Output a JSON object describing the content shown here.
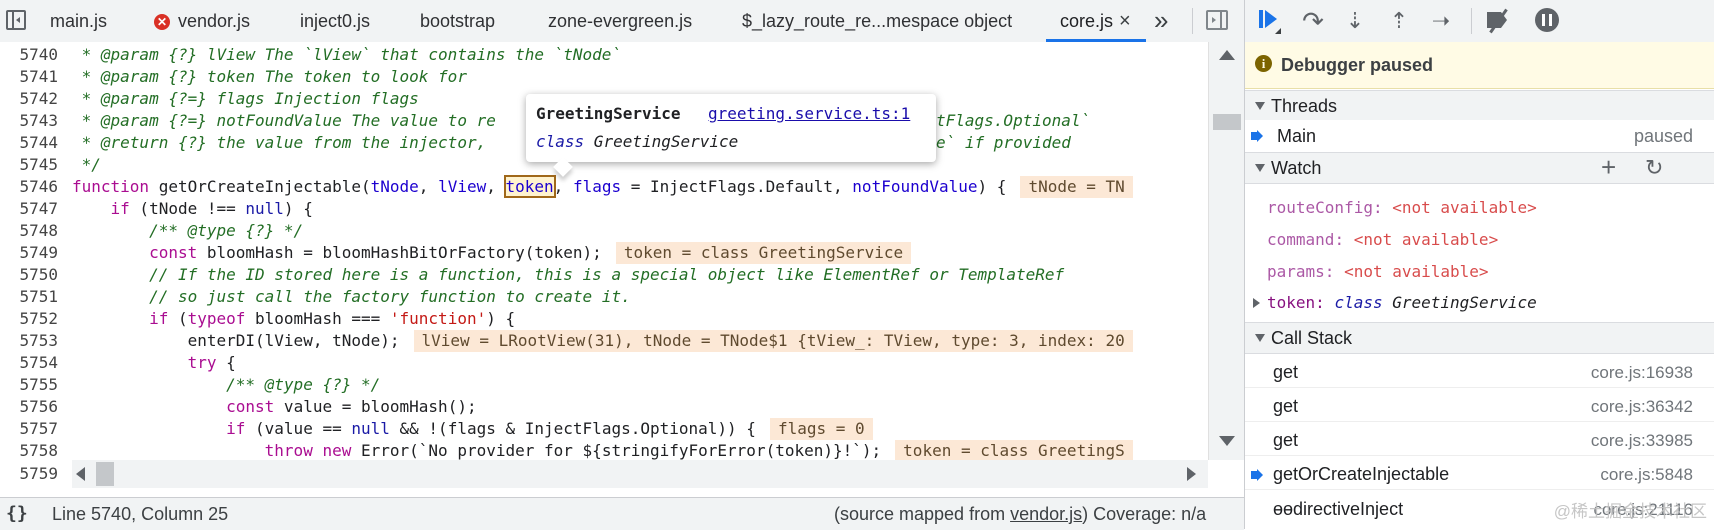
{
  "tabs": [
    {
      "label": "main.js"
    },
    {
      "label": "vendor.js",
      "has_error": true
    },
    {
      "label": "inject0.js"
    },
    {
      "label": "bootstrap"
    },
    {
      "label": "zone-evergreen.js"
    },
    {
      "label": "$_lazy_route_re...mespace object"
    },
    {
      "label": "core.js",
      "active": true,
      "close_icon": "×"
    }
  ],
  "tab_overflow_icon": "»",
  "code": {
    "line_numbers": [
      "5740",
      "5741",
      "5742",
      "5743",
      "5744",
      "5745",
      "5746",
      "5747",
      "5748",
      "5749",
      "5750",
      "5751",
      "5752",
      "5753",
      "5754",
      "5755",
      "5756",
      "5757",
      "5758"
    ],
    "last_line_number": "5759",
    "l5740": " * @param {?} lView The `lView` that contains the `tNode`",
    "l5741": " * @param {?} token The token to look for",
    "l5742": " * @param {?=} flags Injection flags",
    "l5743a": " * @param {?=} notFoundValue The value to re",
    "l5743b": "tFlags.Optional`",
    "l5744a": " * @return {?} the value from the injector,",
    "l5744b": "e` if provided",
    "l5745": " */",
    "l5746": {
      "kw": "function",
      "fn": " getOrCreateInjectable",
      "p1": "(",
      "a1": "tNode",
      "p2": ", ",
      "a2": "lView",
      "p3": ", ",
      "a3": "token",
      "p4": ", ",
      "a4": "flags",
      "p5": " = InjectFlags.Default, ",
      "a5": "notFoundValue",
      "p6": ") {",
      "val": "tNode = TN"
    },
    "l5747": {
      "indent": "    ",
      "kw": "if",
      "rest_a": " (tNode !== ",
      "kwb": "null",
      "rest_b": ") {"
    },
    "l5748": {
      "indent": "        ",
      "cm": "/** @type {?} */"
    },
    "l5749": {
      "indent": "        ",
      "kw": "const",
      "rest": " bloomHash = bloomHashBitOrFactory(token);",
      "val": "token = class GreetingService"
    },
    "l5750": {
      "indent": "        ",
      "cm": "// If the ID stored here is a function, this is a special object like ElementRef or TemplateRef"
    },
    "l5751": {
      "indent": "        ",
      "cm": "// so just call the factory function to create it."
    },
    "l5752": {
      "indent": "        ",
      "kw": "if",
      "rest_a": " (",
      "kw2": "typeof",
      "rest_b": " bloomHash === ",
      "str": "'function'",
      "rest_c": ") {"
    },
    "l5753": {
      "indent": "            ",
      "rest": "enterDI(lView, tNode);",
      "val": "lView = LRootView(31), tNode = TNode$1 {tView_: TView, type: 3, index: 20"
    },
    "l5754": {
      "indent": "            ",
      "kw": "try",
      "rest": " {"
    },
    "l5755": {
      "indent": "                ",
      "cm": "/** @type {?} */"
    },
    "l5756": {
      "indent": "                ",
      "kw": "const",
      "rest": " value = bloomHash();"
    },
    "l5757": {
      "indent": "                ",
      "kw": "if",
      "rest_a": " (value == ",
      "kwb": "null",
      "rest_b": " && !(flags & InjectFlags.Optional)) {",
      "val": "flags = 0"
    },
    "l5758": {
      "indent": "                    ",
      "kw": "throw new",
      "rest_a": " Error(`No provider for ${stringifyForError(token)}!`);",
      "val": "token = class GreetingS"
    }
  },
  "tooltip": {
    "name": "GreetingService",
    "link": "greeting.service.ts:1",
    "class_kw": "class",
    "class_name": " GreetingService"
  },
  "status": {
    "icon": "{}",
    "position": "Line 5740, Column 25",
    "source_prefix": "(source mapped from ",
    "source_file": "vendor.js",
    "source_suffix": ")",
    "coverage": " Coverage: n/a"
  },
  "debugger": {
    "toolbar_icons": [
      "resume-icon",
      "step-over-icon",
      "step-into-icon",
      "step-out-icon",
      "step-icon",
      "deactivate-breakpoints-icon",
      "pause-on-exceptions-icon"
    ],
    "paused_message": "Debugger paused",
    "threads_title": "Threads",
    "thread": {
      "name": "Main",
      "status": "paused"
    },
    "watch_title": "Watch",
    "watch_add": "+",
    "watch_refresh": "↻",
    "watch": [
      {
        "name": "routeConfig",
        "value": "<not available>"
      },
      {
        "name": "command",
        "value": "<not available>"
      },
      {
        "name": "params",
        "value": "<not available>"
      }
    ],
    "watch_token": {
      "name": "token",
      "kw": "class",
      "value": " GreetingService"
    },
    "callstack_title": "Call Stack",
    "callstack": [
      {
        "name": "get",
        "location": "core.js:16938"
      },
      {
        "name": "get",
        "location": "core.js:36342"
      },
      {
        "name": "get",
        "location": "core.js:33985"
      },
      {
        "name": "getOrCreateInjectable",
        "location": "core.js:5848",
        "current": true
      },
      {
        "name": "ɵɵdirectiveInject",
        "location": "core.js:21116"
      }
    ]
  },
  "watermark": "@稀土掘金技术社区"
}
